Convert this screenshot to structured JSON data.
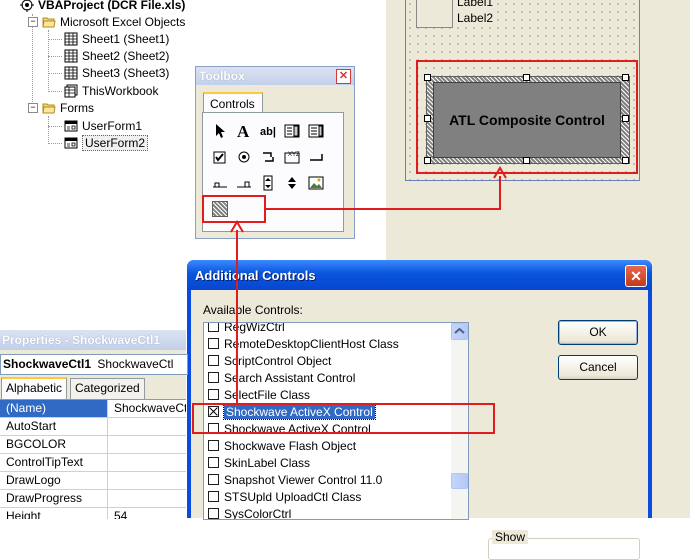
{
  "colors": {
    "highlight_red": "#e01c1c",
    "selection_blue": "#316ac5",
    "xp_title_blue": "#0855dd"
  },
  "project_tree": {
    "root": {
      "label": "VBAProject (DCR File.xls)",
      "icon": "vba-project-icon"
    },
    "excel_objects": {
      "label": "Microsoft Excel Objects",
      "items": [
        "Sheet1 (Sheet1)",
        "Sheet2 (Sheet2)",
        "Sheet3 (Sheet3)",
        "ThisWorkbook"
      ]
    },
    "forms": {
      "label": "Forms",
      "items": [
        "UserForm1",
        "UserForm2"
      ],
      "selected": "UserForm2"
    }
  },
  "form_designer": {
    "labels": [
      "Label1",
      "Label2"
    ],
    "composite_control_caption": "ATL Composite Control"
  },
  "toolbox": {
    "title": "Toolbox",
    "close_glyph": "✕",
    "tab": "Controls",
    "tools": [
      "select-objects-icon",
      "label-tool-icon",
      "textbox-tool-icon",
      "combobox-tool-icon",
      "listbox-tool-icon",
      "checkbox-tool-icon",
      "optionbutton-tool-icon",
      "togglebutton-tool-icon",
      "frame-tool-icon",
      "commandbutton-tool-icon",
      "tabstrip-tool-icon",
      "multipage-tool-icon",
      "scrollbar-tool-icon",
      "spinbutton-tool-icon",
      "image-tool-icon",
      "shockwave-tool-icon"
    ]
  },
  "additional_controls": {
    "title": "Additional Controls",
    "close_glyph": "✕",
    "available_label": "Available Controls:",
    "items": [
      {
        "label": "RegWizCtrl",
        "checked": false
      },
      {
        "label": "RemoteDesktopClientHost Class",
        "checked": false
      },
      {
        "label": "ScriptControl Object",
        "checked": false
      },
      {
        "label": "Search Assistant Control",
        "checked": false
      },
      {
        "label": "SelectFile Class",
        "checked": false
      },
      {
        "label": "Shockwave ActiveX Control",
        "checked": true,
        "selected": true
      },
      {
        "label": "Shockwave ActiveX Control",
        "checked": false
      },
      {
        "label": "Shockwave Flash Object",
        "checked": false
      },
      {
        "label": "SkinLabel Class",
        "checked": false
      },
      {
        "label": "Snapshot Viewer Control 11.0",
        "checked": false
      },
      {
        "label": "STSUpld UploadCtl Class",
        "checked": false
      },
      {
        "label": "SysColorCtrl",
        "checked": false
      }
    ],
    "ok_label": "OK",
    "cancel_label": "Cancel",
    "show_label": "Show"
  },
  "properties": {
    "title": "Properties - ShockwaveCtl1",
    "object_name": "ShockwaveCtl1",
    "object_type": "ShockwaveCtl",
    "tabs": [
      "Alphabetic",
      "Categorized"
    ],
    "rows": [
      {
        "name": "(Name)",
        "value": "ShockwaveCtl1",
        "selected": true
      },
      {
        "name": "AutoStart",
        "value": ""
      },
      {
        "name": "BGCOLOR",
        "value": ""
      },
      {
        "name": "ControlTipText",
        "value": ""
      },
      {
        "name": "DrawLogo",
        "value": ""
      },
      {
        "name": "DrawProgress",
        "value": ""
      },
      {
        "name": "Height",
        "value": "54"
      }
    ]
  }
}
